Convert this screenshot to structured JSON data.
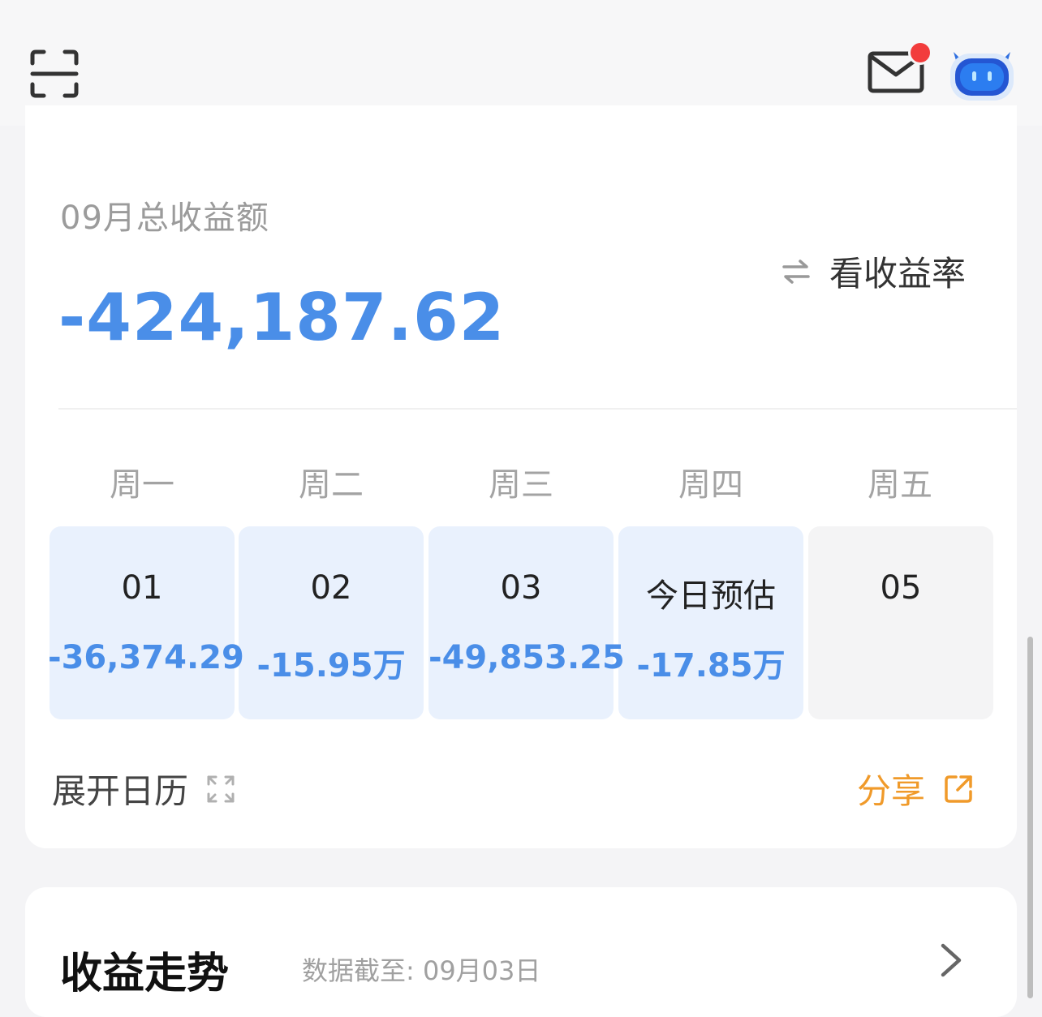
{
  "header": {
    "scan_icon": "scan-icon",
    "mail_icon": "mail-icon",
    "avatar_icon": "robot-avatar-icon",
    "notification_color": "#f23c3c"
  },
  "summary": {
    "label": "09月总收益额",
    "value": "-424,187.62",
    "toggle_label": "看收益率",
    "value_color": "#4a8ee8"
  },
  "weekdays": [
    "周一",
    "周二",
    "周三",
    "周四",
    "周五"
  ],
  "days": [
    {
      "label": "01",
      "value": "-36,374.29"
    },
    {
      "label": "02",
      "value": "-15.95万"
    },
    {
      "label": "03",
      "value": "-49,853.25"
    },
    {
      "label": "今日预估",
      "value": "-17.85万"
    },
    {
      "label": "05",
      "value": ""
    }
  ],
  "footer": {
    "expand_label": "展开日历",
    "share_label": "分享",
    "share_color": "#f09a2a"
  },
  "trend": {
    "title": "收益走势",
    "date_note": "数据截至: 09月03日"
  }
}
